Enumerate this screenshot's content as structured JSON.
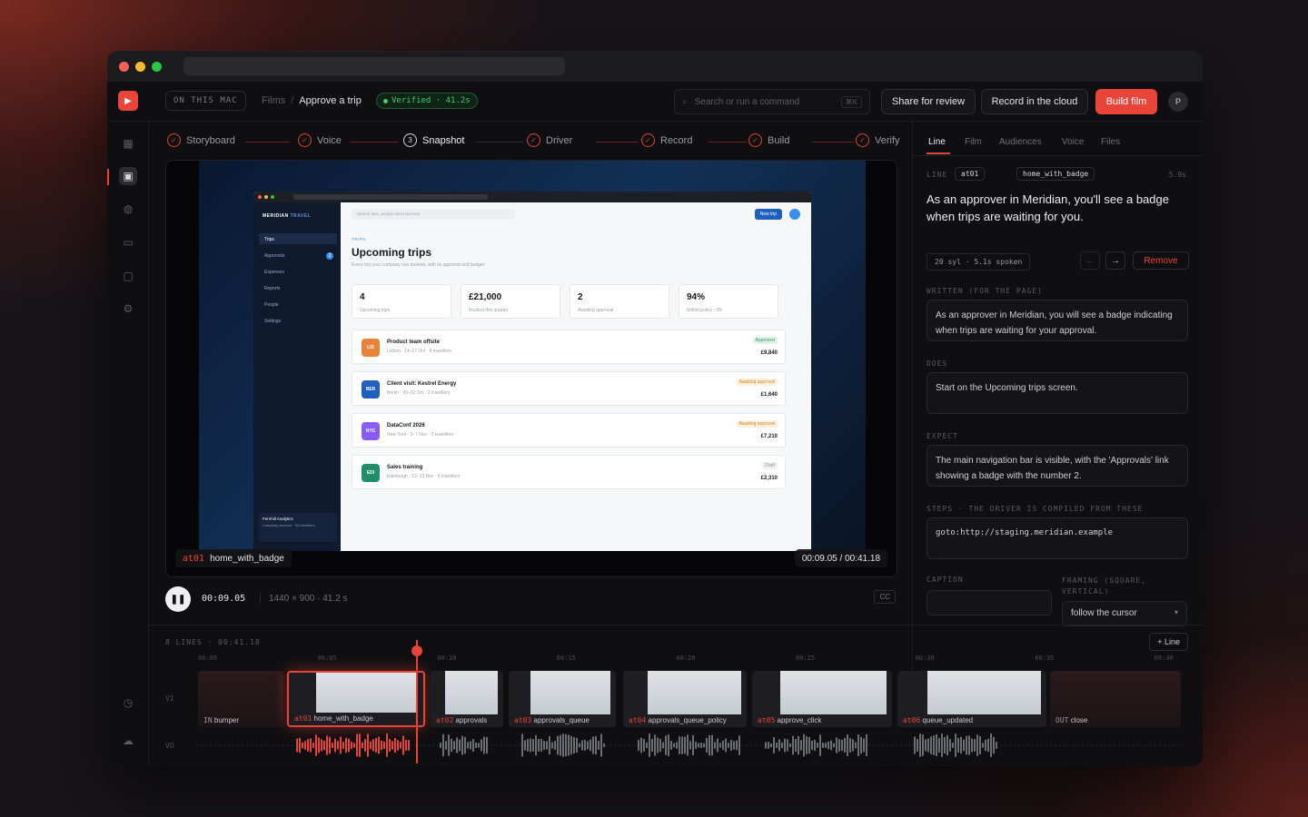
{
  "topbar": {
    "location": "ON THIS MAC",
    "breadcrumb_root": "Films",
    "breadcrumb_sep": "/",
    "breadcrumb_current": "Approve a trip",
    "verified": "Verified · 41.2s",
    "search_placeholder": "Search or run a command",
    "search_shortcut": "⌘K",
    "share_label": "Share for review",
    "record_label": "Record in the cloud",
    "build_label": "Build film",
    "avatar": "P"
  },
  "steps": [
    "Storyboard",
    "Voice",
    "Snapshot",
    "Driver",
    "Record",
    "Build",
    "Verify"
  ],
  "steps_snapshot_num": "3",
  "preview": {
    "app_brand": "MERIDIAN",
    "app_brand2": "TRAVEL",
    "nav": [
      "Trips",
      "Approvals",
      "Expenses",
      "Reports",
      "People",
      "Settings"
    ],
    "approvals_badge": "2",
    "search_placeholder": "Search trips, people and expenses",
    "new_trip": "New trip",
    "section_tag": "TRIPS",
    "heading": "Upcoming trips",
    "subheading": "Every trip your company has booked, with its approval and budget",
    "stats": [
      {
        "value": "4",
        "label": "Upcoming trips"
      },
      {
        "value": "£21,000",
        "label": "Booked this quarter"
      },
      {
        "value": "2",
        "label": "Awaiting approval"
      },
      {
        "value": "94%",
        "label": "Within policy ↑3%"
      }
    ],
    "trips": [
      {
        "code": "LIS",
        "title": "Product team offsite",
        "sub": "Lisbon · 14–17 Oct · 8 travellers",
        "status": "Approved",
        "amount": "£9,840",
        "color": "#e8833a",
        "status_color": "#2f9d5b"
      },
      {
        "code": "BER",
        "title": "Client visit: Kestrel Energy",
        "sub": "Berlin · 20–22 Oct · 2 travellers",
        "status": "Awaiting approval",
        "amount": "£1,640",
        "color": "#1f5fbf",
        "status_color": "#d88a1a"
      },
      {
        "code": "NYC",
        "title": "DataConf 2026",
        "sub": "New York · 3–7 Nov · 3 travellers",
        "status": "Awaiting approval",
        "amount": "£7,210",
        "color": "#8a5cf0",
        "status_color": "#d88a1a"
      },
      {
        "code": "EDI",
        "title": "Sales training",
        "sub": "Edinburgh · 12–13 Nov · 6 travellers",
        "status": "Draft",
        "amount": "£2,310",
        "color": "#1f8f6a",
        "status_color": "#8a8f98"
      }
    ],
    "account_name": "Fernhill Analytics",
    "account_sub": "Company account · 54 travellers",
    "line_tag": "at01",
    "line_name": "home_with_badge",
    "timecode": "00:09.05 / 00:41.18"
  },
  "controls": {
    "time": "00:09.05",
    "dims": "1440 × 900 · 41.2 s",
    "cc": "CC"
  },
  "panel": {
    "tabs": [
      "Line",
      "Film",
      "Audiences",
      "Voice",
      "Files"
    ],
    "line_label": "LINE",
    "line_id": "at01",
    "line_name": "home_with_badge",
    "duration": "5.9s",
    "spoken": "As an approver in Meridian, you'll see a badge when trips are waiting for you.",
    "syllables": "20 syl · 5.1s spoken",
    "remove": "Remove",
    "written_label": "WRITTEN (FOR THE PAGE)",
    "written": "As an approver in Meridian, you will see a badge indicating when trips are waiting for your approval.",
    "does_label": "DOES",
    "does": "Start on the Upcoming trips screen.",
    "expect_label": "EXPECT",
    "expect": "The main navigation bar is visible, with the 'Approvals' link showing a badge with the number 2.",
    "steps_label": "STEPS · THE DRIVER IS COMPILED FROM THESE",
    "steps_code": "goto:http://staging.meridian.example",
    "caption_label": "CAPTION",
    "framing_label": "FRAMING (SQUARE, VERTICAL)",
    "framing_value": "follow the cursor"
  },
  "timeline": {
    "summary": "8 LINES · 00:41.18",
    "add_line": "+ Line",
    "ticks": [
      "00:00",
      "00:05",
      "00:10",
      "00:15",
      "00:20",
      "00:25",
      "00:30",
      "00:35",
      "00:40"
    ],
    "v1": "V1",
    "vo": "VO",
    "clips": [
      {
        "tag": "IN",
        "name": "bumper"
      },
      {
        "tag": "at01",
        "name": "home_with_badge"
      },
      {
        "tag": "at02",
        "name": "approvals"
      },
      {
        "tag": "at03",
        "name": "approvals_queue"
      },
      {
        "tag": "at04",
        "name": "approvals_queue_policy"
      },
      {
        "tag": "at05",
        "name": "approve_click"
      },
      {
        "tag": "at06",
        "name": "queue_updated"
      },
      {
        "tag": "OUT",
        "name": "close"
      }
    ]
  },
  "colors": {
    "accent": "#e8443a",
    "verified": "#3ecf6a"
  }
}
